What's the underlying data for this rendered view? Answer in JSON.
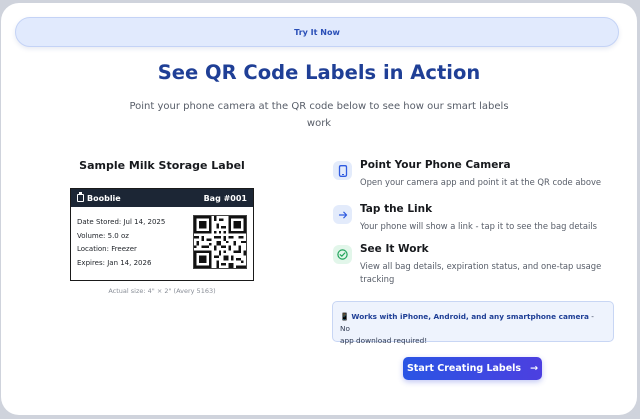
{
  "banner": {
    "label": "Try It Now"
  },
  "hero": {
    "title": "See QR Code Labels in Action",
    "subtitle_line1": "Point your phone camera at the QR code below to see how our smart labels",
    "subtitle_line2": "work"
  },
  "sample": {
    "heading": "Sample Milk Storage Label",
    "brand": "Booblie",
    "bag_number": "Bag #001",
    "lines": [
      "Date Stored: Jul 14, 2025",
      "Volume: 5.0 oz",
      "Location: Freezer",
      "Expires: Jan 14, 2026"
    ],
    "actual_size": "Actual size: 4\" × 2\" (Avery 5163)"
  },
  "steps": [
    {
      "title": "Point Your Phone Camera",
      "desc": "Open your camera app and point it at the QR code above",
      "icon": "phone-icon"
    },
    {
      "title": "Tap the Link",
      "desc": "Your phone will show a link - tap it to see the bag details",
      "icon": "arrow-right-icon"
    },
    {
      "title": "See It Work",
      "desc_line1": "View all bag details, expiration status, and one-tap usage",
      "desc_line2": "tracking",
      "icon": "check-circle-icon"
    }
  ],
  "compat": {
    "icon": "📱",
    "bold": "Works with iPhone, Android, and any smartphone camera",
    "rest_prefix": " - No",
    "rest_line2": "app download required!"
  },
  "cta": {
    "label": "Start Creating Labels",
    "arrow": "→"
  },
  "colors": {
    "accent": "#1f3f96",
    "button": "#2a55e4",
    "banner_bg": "#e1eafd"
  }
}
